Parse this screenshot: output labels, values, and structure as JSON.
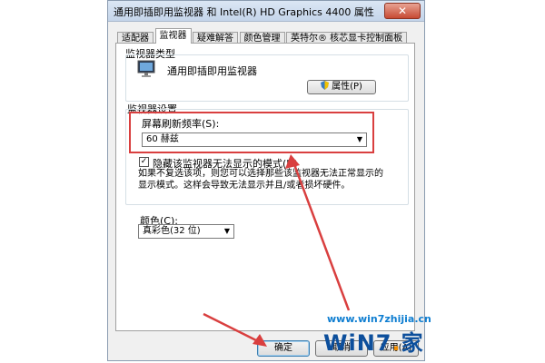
{
  "window": {
    "title": "通用即插即用监视器 和 Intel(R) HD Graphics 4400 属性",
    "close_glyph": "✕"
  },
  "tabs": [
    {
      "label": "适配器",
      "active": false
    },
    {
      "label": "监视器",
      "active": true
    },
    {
      "label": "疑难解答",
      "active": false
    },
    {
      "label": "颜色管理",
      "active": false
    },
    {
      "label": "英特尔® 核芯显卡控制面板",
      "active": false
    }
  ],
  "monitor_type": {
    "group_label": "监视器类型",
    "monitor_name": "通用即插即用监视器",
    "properties_button": "属性(P)",
    "icon": "monitor-icon"
  },
  "monitor_settings": {
    "group_label": "监视器设置",
    "refresh_label": "屏幕刷新频率(S):",
    "refresh_value": "60 赫兹",
    "hide_modes_checked": true,
    "hide_modes_label": "隐藏该监视器无法显示的模式(H)",
    "description_lines": [
      "如果不复选该项，则您可以选择那些该监视器无法正常显示的",
      "显示模式。这样会导致无法显示并且/或者损坏硬件。"
    ]
  },
  "colors": {
    "label": "颜色(C):",
    "value": "真彩色(32 位)"
  },
  "footer": {
    "ok": "确定",
    "cancel": "取消",
    "apply": "应用(A)"
  },
  "watermark": {
    "url": "www.win7zhijia.cn",
    "logo_main": "WiN7",
    "logo_dot": ".",
    "logo_tail": "家"
  },
  "annotation_color": "#d93f3f",
  "accent_color": "#3c7fb1"
}
